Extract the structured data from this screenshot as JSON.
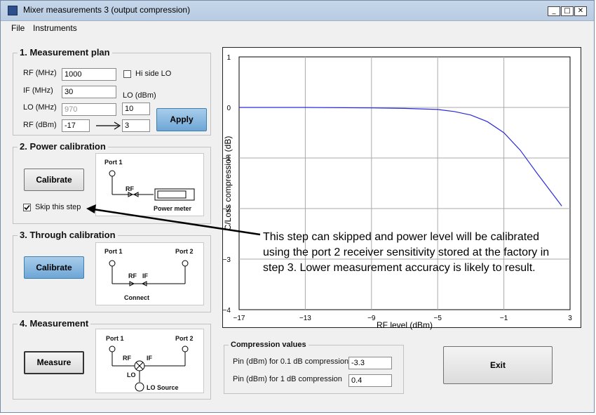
{
  "window": {
    "title": "Mixer measurements 3 (output compression)"
  },
  "menu": {
    "file": "File",
    "instruments": "Instruments"
  },
  "plan": {
    "title": "1. Measurement plan",
    "rf_label": "RF (MHz)",
    "rf_value": "1000",
    "hi_side_label": "Hi side LO",
    "if_label": "IF (MHz)",
    "if_value": "30",
    "lo_label": "LO (MHz)",
    "lo_value": "970",
    "lo_dbm_label": "LO (dBm)",
    "lo_dbm_value": "10",
    "rf_dbm_label": "RF (dBm)",
    "rf_dbm_from": "-17",
    "rf_dbm_to": "3",
    "apply_label": "Apply"
  },
  "power_cal": {
    "title": "2. Power calibration",
    "calibrate_label": "Calibrate",
    "skip_label": "Skip this step",
    "diagram": {
      "port1": "Port 1",
      "rf": "RF",
      "power_meter": "Power meter"
    }
  },
  "through_cal": {
    "title": "3. Through calibration",
    "calibrate_label": "Calibrate",
    "diagram": {
      "port1": "Port 1",
      "port2": "Port 2",
      "rf": "RF",
      "if": "IF",
      "connect": "Connect"
    }
  },
  "measurement": {
    "title": "4. Measurement",
    "measure_label": "Measure",
    "diagram": {
      "port1": "Port 1",
      "port2": "Port 2",
      "rf": "RF",
      "if": "IF",
      "lo": "LO",
      "lo_source": "LO Source"
    }
  },
  "annotation": "This step can skipped and power level will be calibrated using the port 2 receiver sensitivity stored at the factory in step 3. Lower measurement accuracy is likely to result.",
  "compression": {
    "title": "Compression values",
    "row1_label": "Pin (dBm) for 0.1 dB compression",
    "row1_value": "-3.3",
    "row2_label": "Pin (dBm) for 1 dB compression",
    "row2_value": "0.4"
  },
  "exit_label": "Exit",
  "colors": {
    "curve": "#2a2adc",
    "accent_button": "#6da6d6"
  },
  "chart_data": {
    "type": "line",
    "xlabel": "RF level (dBm)",
    "ylabel": "C/Loss compression (dB)",
    "xlim": [
      -17,
      3
    ],
    "ylim": [
      -4,
      1
    ],
    "xticks": [
      -17,
      -13,
      -9,
      -5,
      -1,
      3
    ],
    "yticks": [
      1,
      0,
      -1,
      -2,
      -3,
      -4
    ],
    "grid": true,
    "series": [
      {
        "x": [
          -17,
          -13,
          -9,
          -7,
          -5,
          -4,
          -3,
          -2,
          -1,
          0,
          1,
          2.5
        ],
        "y": [
          0,
          0,
          -0.01,
          -0.02,
          -0.04,
          -0.08,
          -0.15,
          -0.28,
          -0.5,
          -0.85,
          -1.3,
          -1.95
        ]
      }
    ]
  }
}
